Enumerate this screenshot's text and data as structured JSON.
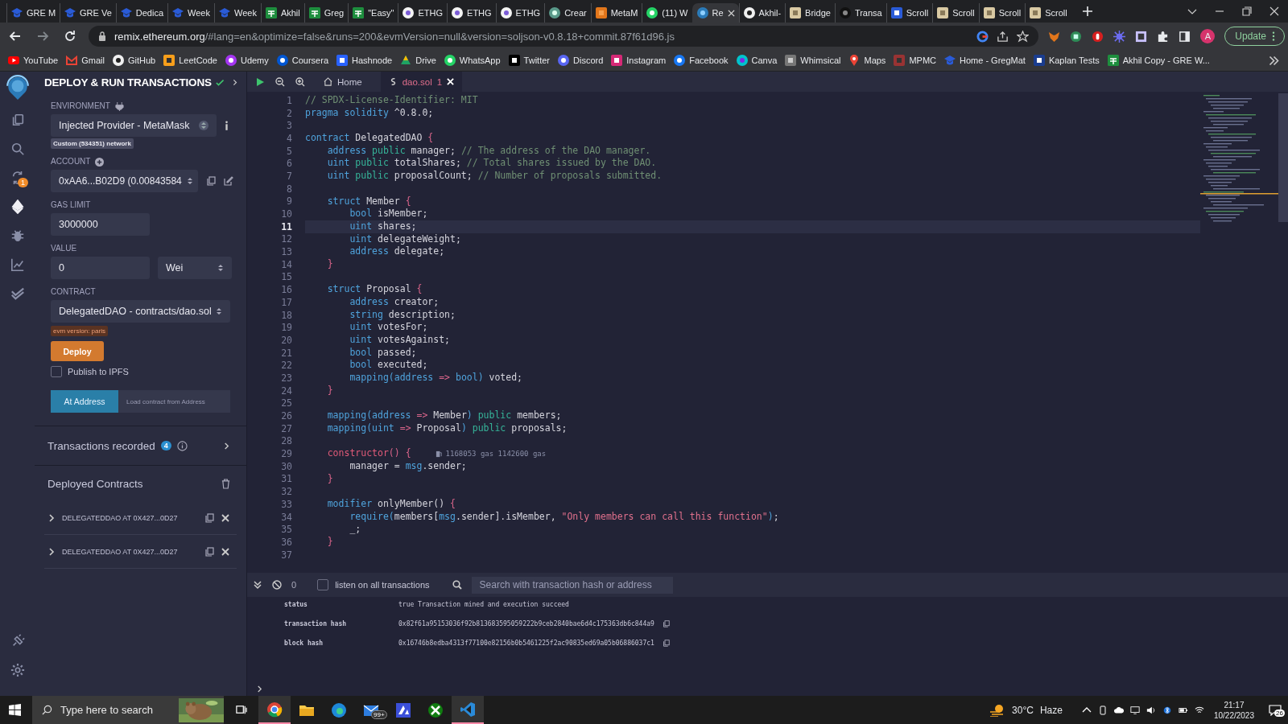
{
  "browser": {
    "tabs": [
      {
        "label": "GRE M",
        "kind": "cap",
        "selected": false
      },
      {
        "label": "GRE Ve",
        "kind": "cap",
        "selected": false
      },
      {
        "label": "Dedica",
        "kind": "cap",
        "selected": false
      },
      {
        "label": "Week",
        "kind": "cap",
        "selected": false
      },
      {
        "label": "Week",
        "kind": "cap",
        "selected": false
      },
      {
        "label": "Akhil",
        "kind": "sheet",
        "selected": false
      },
      {
        "label": "Greg",
        "kind": "sheet",
        "selected": false
      },
      {
        "label": "\"Easy\"",
        "kind": "sheet",
        "selected": false
      },
      {
        "label": "ETHG",
        "kind": "ethg",
        "selected": false
      },
      {
        "label": "ETHG",
        "kind": "ethg",
        "selected": false
      },
      {
        "label": "ETHG",
        "kind": "ethg",
        "selected": false
      },
      {
        "label": "Crear",
        "kind": "chat",
        "selected": false
      },
      {
        "label": "MetaM",
        "kind": "fox",
        "selected": false
      },
      {
        "label": "(11) W",
        "kind": "whatsapp",
        "selected": false
      },
      {
        "label": "Re",
        "kind": "remix",
        "selected": true
      },
      {
        "label": "Akhil-",
        "kind": "github",
        "selected": false
      },
      {
        "label": "Bridge",
        "kind": "scroll",
        "selected": false
      },
      {
        "label": "Transa",
        "kind": "dark",
        "selected": false
      },
      {
        "label": "Scroll",
        "kind": "scrollblue",
        "selected": false
      },
      {
        "label": "Scroll",
        "kind": "scroll",
        "selected": false
      },
      {
        "label": "Scroll",
        "kind": "scroll",
        "selected": false
      },
      {
        "label": "Scroll",
        "kind": "scroll",
        "selected": false
      }
    ],
    "url_host": "remix.ethereum.org",
    "url_path": "/#lang=en&optimize=false&runs=200&evmVersion=null&version=soljson-v0.8.18+commit.87f61d96.js",
    "avatar": "A",
    "update_button": "Update",
    "bookmarks": [
      {
        "label": "YouTube",
        "kind": "youtube"
      },
      {
        "label": "Gmail",
        "kind": "gmail"
      },
      {
        "label": "GitHub",
        "kind": "github"
      },
      {
        "label": "LeetCode",
        "kind": "leetcode"
      },
      {
        "label": "Udemy",
        "kind": "udemy"
      },
      {
        "label": "Coursera",
        "kind": "coursera"
      },
      {
        "label": "Hashnode",
        "kind": "hashnode"
      },
      {
        "label": "Drive",
        "kind": "drive"
      },
      {
        "label": "WhatsApp",
        "kind": "whatsapp"
      },
      {
        "label": "Twitter",
        "kind": "x"
      },
      {
        "label": "Discord",
        "kind": "discord"
      },
      {
        "label": "Instagram",
        "kind": "instagram"
      },
      {
        "label": "Facebook",
        "kind": "facebook"
      },
      {
        "label": "Canva",
        "kind": "canva"
      },
      {
        "label": "Whimsical",
        "kind": "whimsical"
      },
      {
        "label": "Maps",
        "kind": "maps"
      },
      {
        "label": "MPMC",
        "kind": "mpmc"
      },
      {
        "label": "Home - GregMat",
        "kind": "cap"
      },
      {
        "label": "Kaplan Tests",
        "kind": "kaplan"
      },
      {
        "label": "Akhil Copy - GRE W...",
        "kind": "sheet"
      }
    ]
  },
  "icon_bar": {
    "top": [
      {
        "kind": "files",
        "selected": false
      },
      {
        "kind": "search",
        "selected": false
      },
      {
        "kind": "compiler",
        "selected": false,
        "badge": "1"
      },
      {
        "kind": "deploy",
        "selected": true
      },
      {
        "kind": "debug",
        "selected": false
      },
      {
        "kind": "analytics",
        "selected": false
      },
      {
        "kind": "verify",
        "selected": false
      }
    ],
    "bottom": [
      {
        "kind": "plugin",
        "selected": false
      },
      {
        "kind": "settings",
        "selected": false
      }
    ]
  },
  "deploy_panel": {
    "title": "DEPLOY & RUN TRANSACTIONS",
    "environment": {
      "label": "ENVIRONMENT",
      "value": "Injected Provider - MetaMask",
      "network": "Custom (534351) network"
    },
    "account": {
      "label": "ACCOUNT",
      "value": "0xAA6...B02D9 (0.00843584"
    },
    "gas_limit": {
      "label": "GAS LIMIT",
      "value": "3000000"
    },
    "value": {
      "label": "VALUE",
      "value": "0",
      "unit": "Wei"
    },
    "contract": {
      "label": "CONTRACT",
      "value": "DelegatedDAO - contracts/dao.sol",
      "evm_version": "evm version: paris"
    },
    "deploy_button": "Deploy",
    "publish": {
      "label": "Publish to IPFS",
      "checked": false
    },
    "at_address": {
      "button": "At Address",
      "placeholder": "Load contract from Address"
    },
    "transactions_recorded": {
      "title": "Transactions recorded",
      "count": "4"
    },
    "deployed_contracts": {
      "title": "Deployed Contracts",
      "instances": [
        {
          "label": "DELEGATEDDAO AT 0X427...0D27",
          "expanded": false
        },
        {
          "label": "DELEGATEDDAO AT 0X427...0D27",
          "expanded": false
        }
      ]
    }
  },
  "editor": {
    "tabs": [
      {
        "label": "Home",
        "kind": "home",
        "selected": false
      },
      {
        "label": "dao.sol",
        "kind": "file",
        "selected": true,
        "problems": "1"
      }
    ],
    "lines": [
      {
        "number": "1",
        "selected": false,
        "tokens": [
          {
            "kind": "c",
            "text": "// SPDX-License-Identifier: MIT"
          }
        ]
      },
      {
        "number": "2",
        "selected": false,
        "tokens": [
          {
            "kind": "kw",
            "text": "pragma solidity"
          },
          {
            "kind": "p",
            "text": " ^0.8.0;"
          }
        ]
      },
      {
        "number": "3",
        "selected": false
      },
      {
        "number": "4",
        "selected": false,
        "tokens": [
          {
            "kind": "kw",
            "text": "contract"
          },
          {
            "kind": "p",
            "text": " DelegatedDAO "
          },
          {
            "kind": "b",
            "text": "{"
          }
        ]
      },
      {
        "number": "5",
        "selected": false,
        "tokens": [
          {
            "kind": "kw",
            "text": "    address"
          },
          {
            "kind": "vis",
            "text": " public"
          },
          {
            "kind": "p",
            "text": " manager; "
          },
          {
            "kind": "c",
            "text": "// The address of the DAO manager."
          }
        ]
      },
      {
        "number": "6",
        "selected": false,
        "tokens": [
          {
            "kind": "kw",
            "text": "    uint"
          },
          {
            "kind": "vis",
            "text": " public"
          },
          {
            "kind": "p",
            "text": " totalShares; "
          },
          {
            "kind": "c",
            "text": "// Total shares issued by the DAO."
          }
        ]
      },
      {
        "number": "7",
        "selected": false,
        "tokens": [
          {
            "kind": "kw",
            "text": "    uint"
          },
          {
            "kind": "vis",
            "text": " public"
          },
          {
            "kind": "p",
            "text": " proposalCount; "
          },
          {
            "kind": "c",
            "text": "// Number of proposals submitted."
          }
        ]
      },
      {
        "number": "8",
        "selected": false
      },
      {
        "number": "9",
        "selected": false,
        "tokens": [
          {
            "kind": "kw",
            "text": "    struct"
          },
          {
            "kind": "p",
            "text": " Member "
          },
          {
            "kind": "b",
            "text": "{"
          }
        ]
      },
      {
        "number": "10",
        "selected": false,
        "tokens": [
          {
            "kind": "kw",
            "text": "        bool"
          },
          {
            "kind": "p",
            "text": " isMember;"
          }
        ]
      },
      {
        "number": "11",
        "selected": true,
        "tokens": [
          {
            "kind": "kw",
            "text": "        uint"
          },
          {
            "kind": "p",
            "text": " shares;"
          }
        ]
      },
      {
        "number": "12",
        "selected": false,
        "tokens": [
          {
            "kind": "kw",
            "text": "        uint"
          },
          {
            "kind": "p",
            "text": " delegateWeight;"
          }
        ]
      },
      {
        "number": "13",
        "selected": false,
        "tokens": [
          {
            "kind": "kw",
            "text": "        address"
          },
          {
            "kind": "p",
            "text": " delegate;"
          }
        ]
      },
      {
        "number": "14",
        "selected": false,
        "tokens": [
          {
            "kind": "b",
            "text": "    }"
          }
        ]
      },
      {
        "number": "15",
        "selected": false
      },
      {
        "number": "16",
        "selected": false,
        "tokens": [
          {
            "kind": "kw",
            "text": "    struct"
          },
          {
            "kind": "p",
            "text": " Proposal "
          },
          {
            "kind": "b",
            "text": "{"
          }
        ]
      },
      {
        "number": "17",
        "selected": false,
        "tokens": [
          {
            "kind": "kw",
            "text": "        address"
          },
          {
            "kind": "p",
            "text": " creator;"
          }
        ]
      },
      {
        "number": "18",
        "selected": false,
        "tokens": [
          {
            "kind": "kw",
            "text": "        string"
          },
          {
            "kind": "p",
            "text": " description;"
          }
        ]
      },
      {
        "number": "19",
        "selected": false,
        "tokens": [
          {
            "kind": "kw",
            "text": "        uint"
          },
          {
            "kind": "p",
            "text": " votesFor;"
          }
        ]
      },
      {
        "number": "20",
        "selected": false,
        "tokens": [
          {
            "kind": "kw",
            "text": "        uint"
          },
          {
            "kind": "p",
            "text": " votesAgainst;"
          }
        ]
      },
      {
        "number": "21",
        "selected": false,
        "tokens": [
          {
            "kind": "kw",
            "text": "        bool"
          },
          {
            "kind": "p",
            "text": " passed;"
          }
        ]
      },
      {
        "number": "22",
        "selected": false,
        "tokens": [
          {
            "kind": "kw",
            "text": "        bool"
          },
          {
            "kind": "p",
            "text": " executed;"
          }
        ]
      },
      {
        "number": "23",
        "selected": false,
        "tokens": [
          {
            "kind": "kw",
            "text": "        mapping(address"
          },
          {
            "kind": "b",
            "text": " =>"
          },
          {
            "kind": "kw",
            "text": " bool)"
          },
          {
            "kind": "p",
            "text": " voted;"
          }
        ]
      },
      {
        "number": "24",
        "selected": false,
        "tokens": [
          {
            "kind": "b",
            "text": "    }"
          }
        ]
      },
      {
        "number": "25",
        "selected": false
      },
      {
        "number": "26",
        "selected": false,
        "tokens": [
          {
            "kind": "kw",
            "text": "    mapping(address"
          },
          {
            "kind": "b",
            "text": " =>"
          },
          {
            "kind": "p",
            "text": " Member"
          },
          {
            "kind": "kw",
            "text": ")"
          },
          {
            "kind": "vis",
            "text": " public"
          },
          {
            "kind": "p",
            "text": " members;"
          }
        ]
      },
      {
        "number": "27",
        "selected": false,
        "tokens": [
          {
            "kind": "kw",
            "text": "    mapping(uint"
          },
          {
            "kind": "b",
            "text": " =>"
          },
          {
            "kind": "p",
            "text": " Proposal"
          },
          {
            "kind": "kw",
            "text": ")"
          },
          {
            "kind": "vis",
            "text": " public"
          },
          {
            "kind": "p",
            "text": " proposals;"
          }
        ]
      },
      {
        "number": "28",
        "selected": false
      },
      {
        "number": "29",
        "selected": false,
        "tokens": [
          {
            "kind": "fn",
            "text": "    constructor"
          },
          {
            "kind": "b",
            "text": "() {"
          }
        ],
        "gas": "1168053 gas 1142600 gas"
      },
      {
        "number": "30",
        "selected": false,
        "tokens": [
          {
            "kind": "p",
            "text": "        manager = "
          },
          {
            "kind": "kw",
            "text": "msg"
          },
          {
            "kind": "p",
            "text": ".sender;"
          }
        ]
      },
      {
        "number": "31",
        "selected": false,
        "tokens": [
          {
            "kind": "b",
            "text": "    }"
          }
        ]
      },
      {
        "number": "32",
        "selected": false
      },
      {
        "number": "33",
        "selected": false,
        "tokens": [
          {
            "kind": "kw",
            "text": "    modifier"
          },
          {
            "kind": "p",
            "text": " onlyMember() "
          },
          {
            "kind": "b",
            "text": "{"
          }
        ]
      },
      {
        "number": "34",
        "selected": false,
        "tokens": [
          {
            "kind": "kw",
            "text": "        require("
          },
          {
            "kind": "p",
            "text": "members["
          },
          {
            "kind": "kw",
            "text": "msg"
          },
          {
            "kind": "p",
            "text": ".sender].isMember, "
          },
          {
            "kind": "s",
            "text": "\"Only members can call this function\""
          },
          {
            "kind": "kw",
            "text": ")"
          },
          {
            "kind": "p",
            "text": ";"
          }
        ]
      },
      {
        "number": "35",
        "selected": false,
        "tokens": [
          {
            "kind": "p",
            "text": "        _;"
          }
        ]
      },
      {
        "number": "36",
        "selected": false,
        "tokens": [
          {
            "kind": "b",
            "text": "    }"
          }
        ]
      },
      {
        "number": "37",
        "selected": false
      }
    ]
  },
  "console": {
    "count": "0",
    "listen": {
      "label": "listen on all transactions",
      "checked": false
    },
    "search_placeholder": "Search with transaction hash or address",
    "rows": [
      {
        "key": "status",
        "value": "true Transaction mined and execution succeed",
        "copyable": false
      },
      {
        "key": "transaction hash",
        "value": "0x82f61a95153036f92b813683595059222b9ceb2840bae6d4c175363db6c844a9",
        "copyable": true
      },
      {
        "key": "block hash",
        "value": "0x16746b8edba4313f77100e82156b0b5461225f2ac90835ed69a05b06886037c1",
        "copyable": true
      }
    ]
  },
  "taskbar": {
    "search_placeholder": "Type here to search",
    "apps": [
      {
        "kind": "chrome",
        "selected": true
      },
      {
        "kind": "explorer",
        "selected": false
      },
      {
        "kind": "edge",
        "selected": false
      },
      {
        "kind": "mail",
        "selected": false,
        "badge": "99+"
      },
      {
        "kind": "store",
        "selected": false
      },
      {
        "kind": "xbox",
        "selected": false
      },
      {
        "kind": "vscode",
        "selected": true
      }
    ],
    "temperature": "30°C",
    "weather": "Haze",
    "time": "21:17",
    "date": "10/22/2023",
    "notifications": "26"
  }
}
